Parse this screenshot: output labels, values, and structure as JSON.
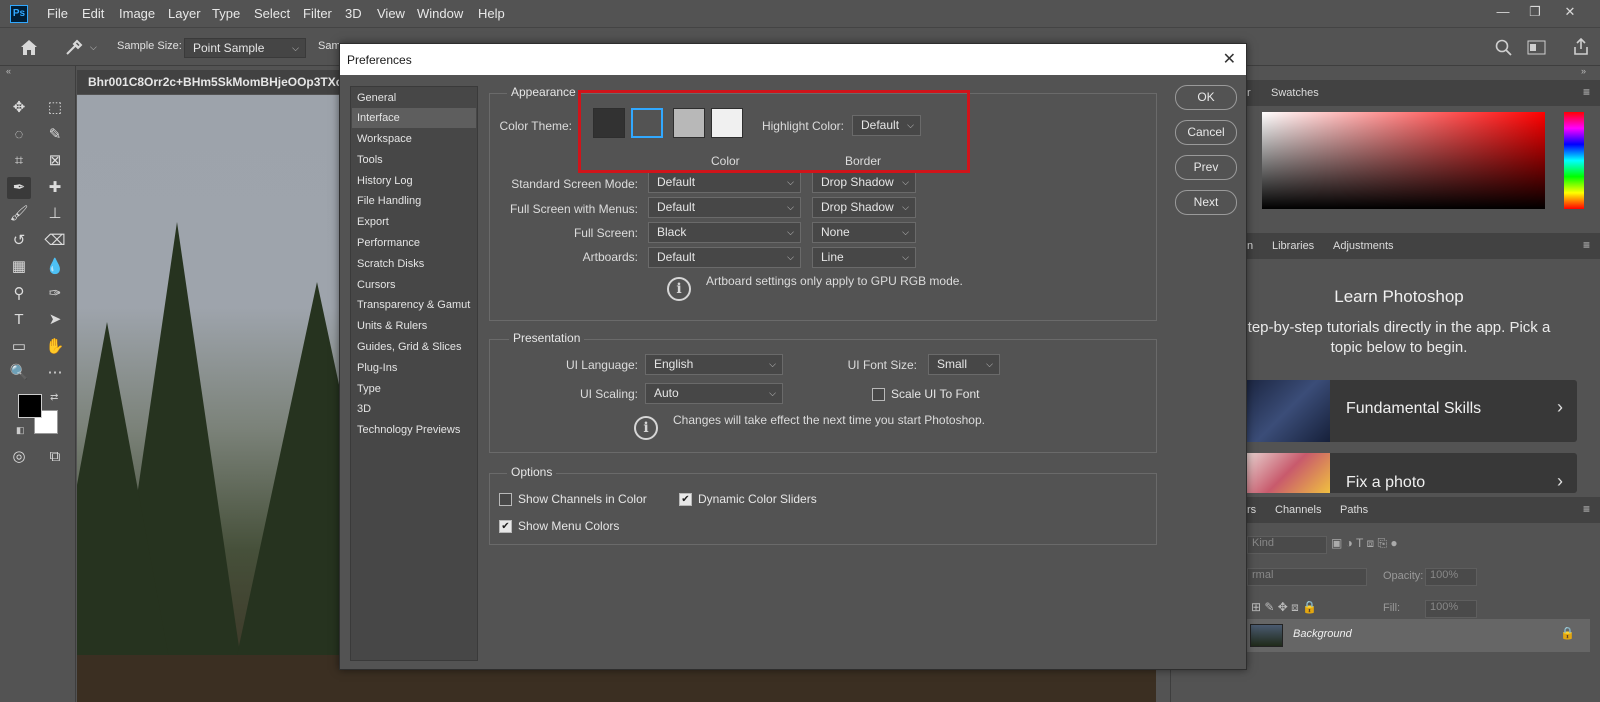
{
  "app": {
    "logo": "Ps"
  },
  "menu": [
    "File",
    "Edit",
    "Image",
    "Layer",
    "Type",
    "Select",
    "Filter",
    "3D",
    "View",
    "Window",
    "Help"
  ],
  "window_controls": {
    "minimize": "—",
    "restore": "❐",
    "close": "✕"
  },
  "options_bar": {
    "sample_size_label": "Sample Size:",
    "sample_size_value": "Point Sample",
    "sample_label_partial": "Sam"
  },
  "document": {
    "title": "Bhr001C8Orr2c+BHm5SkMomBHjeOOp3TXc"
  },
  "right_panels": {
    "color_tabs": [
      "r",
      "Swatches"
    ],
    "learn_tabs": [
      "n",
      "Libraries",
      "Adjustments"
    ],
    "learn_title": "Learn Photoshop",
    "learn_desc": "tep-by-step tutorials directly in the app. Pick a topic below to begin.",
    "cards": [
      "Fundamental Skills",
      "Fix a photo"
    ],
    "layer_tabs": [
      "rs",
      "Channels",
      "Paths"
    ],
    "kind_label": "Kind",
    "blend_mode": "rmal",
    "opacity_label": "Opacity:",
    "opacity_value": "100%",
    "fill_label": "Fill:",
    "fill_value": "100%",
    "layer_name": "Background"
  },
  "dialog": {
    "title": "Preferences",
    "close_glyph": "✕",
    "nav_items": [
      "General",
      "Interface",
      "Workspace",
      "Tools",
      "History Log",
      "File Handling",
      "Export",
      "Performance",
      "Scratch Disks",
      "Cursors",
      "Transparency & Gamut",
      "Units & Rulers",
      "Guides, Grid & Slices",
      "Plug-Ins",
      "Type",
      "3D",
      "Technology Previews"
    ],
    "selected_nav": "Interface",
    "appearance": {
      "group_label": "Appearance",
      "color_theme_label": "Color Theme:",
      "theme_swatches": [
        "#323232",
        "#535353",
        "#b8b8b8",
        "#f0f0f0"
      ],
      "highlight_label": "Highlight Color:",
      "highlight_value": "Default",
      "col_color": "Color",
      "col_border": "Border",
      "rows": [
        {
          "label": "Standard Screen Mode:",
          "color": "Default",
          "border": "Drop Shadow"
        },
        {
          "label": "Full Screen with Menus:",
          "color": "Default",
          "border": "Drop Shadow"
        },
        {
          "label": "Full Screen:",
          "color": "Black",
          "border": "None"
        },
        {
          "label": "Artboards:",
          "color": "Default",
          "border": "Line"
        }
      ],
      "artboard_note": "Artboard settings only apply to GPU RGB mode."
    },
    "presentation": {
      "group_label": "Presentation",
      "ui_language_label": "UI Language:",
      "ui_language_value": "English",
      "ui_font_size_label": "UI Font Size:",
      "ui_font_size_value": "Small",
      "ui_scaling_label": "UI Scaling:",
      "ui_scaling_value": "Auto",
      "scale_ui_label": "Scale UI To Font",
      "restart_note": "Changes will take effect the next time you start Photoshop."
    },
    "options": {
      "group_label": "Options",
      "show_channels_label": "Show Channels in Color",
      "show_channels_checked": false,
      "dynamic_sliders_label": "Dynamic Color Sliders",
      "dynamic_sliders_checked": true,
      "show_menu_colors_label": "Show Menu Colors",
      "show_menu_colors_checked": true
    },
    "buttons": {
      "ok": "OK",
      "cancel": "Cancel",
      "prev": "Prev",
      "next": "Next"
    },
    "info_glyph": "i",
    "check_glyph": "✔"
  },
  "colors": {
    "highlight_border": "#d0141a",
    "selected_swatch_border": "#31a8ff"
  }
}
